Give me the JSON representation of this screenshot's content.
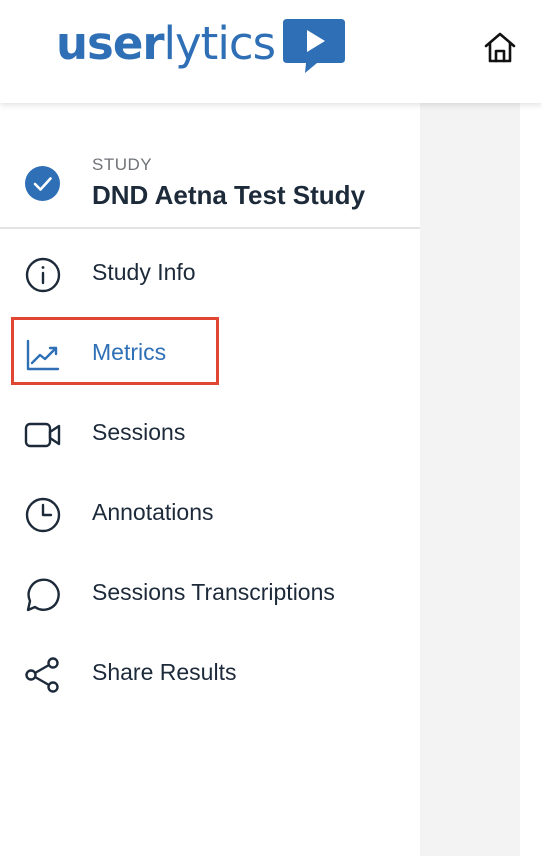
{
  "header": {
    "logo": {
      "text_bold": "user",
      "text_light": "lytics"
    },
    "home_icon": "home-icon"
  },
  "sidebar": {
    "study": {
      "label": "STUDY",
      "name": "DND Aetna Test Study",
      "icon": "check-circle-icon"
    },
    "items": [
      {
        "label": "Study Info",
        "icon": "info-icon",
        "active": false
      },
      {
        "label": "Metrics",
        "icon": "trending-chart-icon",
        "active": true
      },
      {
        "label": "Sessions",
        "icon": "video-camera-icon",
        "active": false
      },
      {
        "label": "Annotations",
        "icon": "clock-icon",
        "active": false
      },
      {
        "label": "Sessions Transcriptions",
        "icon": "chat-bubble-icon",
        "active": false
      },
      {
        "label": "Share Results",
        "icon": "share-icon",
        "active": false
      }
    ]
  },
  "colors": {
    "brand": "#2e6fb6",
    "text": "#1d2a3a",
    "muted": "#6f7377",
    "highlight": "#e04632",
    "panel": "#f3f3f4"
  }
}
